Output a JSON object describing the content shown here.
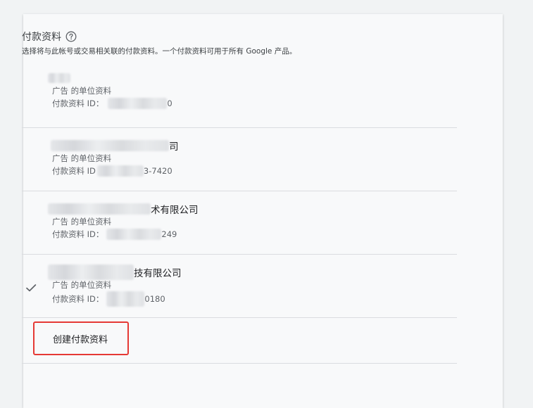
{
  "header": {
    "title": "付款资料",
    "help_icon": "help-circle-icon",
    "subtitle": "选择将与此帐号或交易相关联的付款资料。一个付款资料可用于所有 Google 产品。"
  },
  "profiles": [
    {
      "name_suffix": "",
      "type": "广告 的单位资料",
      "id_label": "付款资料 ID：",
      "id_suffix": "0",
      "selected": false
    },
    {
      "name_suffix": "司",
      "type": "广告 的单位资料",
      "id_label": "付款资料 ID",
      "id_suffix": "3-7420",
      "selected": false
    },
    {
      "name_suffix": "术有限公司",
      "type": "广告 的单位资料",
      "id_label": "付款资料 ID：",
      "id_suffix": "249",
      "selected": false
    },
    {
      "name_suffix": "技有限公司",
      "type": "广告 的单位资料",
      "id_label": "付款资料 ID：",
      "id_suffix": "0180",
      "selected": true
    }
  ],
  "create_button": {
    "label": "创建付款资料"
  },
  "colors": {
    "highlight_border": "#e53935",
    "divider": "#dadce0",
    "card_bg": "#f8f9fa"
  }
}
